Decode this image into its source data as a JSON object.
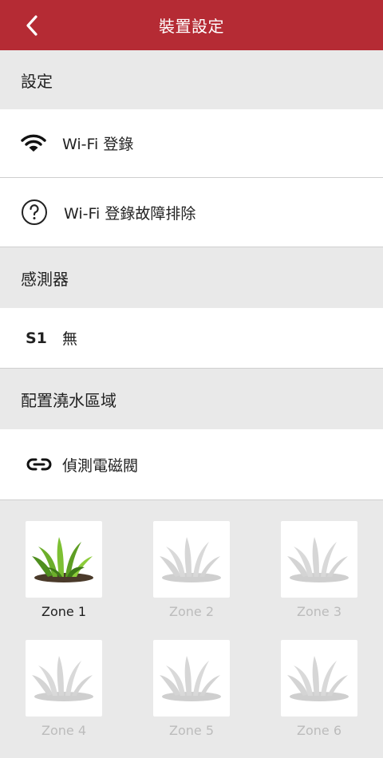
{
  "header": {
    "title": "裝置設定",
    "back_icon": "chevron-left-icon"
  },
  "settings": {
    "section_label": "設定",
    "wifi_login": {
      "label": "Wi-Fi 登錄",
      "icon": "wifi-icon"
    },
    "wifi_troubleshoot": {
      "label": "Wi-Fi 登錄故障排除",
      "icon": "help-circle-icon"
    }
  },
  "sensors": {
    "section_label": "感測器",
    "s1": {
      "code": "S1",
      "value": "無"
    }
  },
  "zones_config": {
    "section_label": "配置澆水區域",
    "detect_valves": {
      "label": "偵測電磁閥",
      "icon": "link-icon"
    }
  },
  "zones": [
    {
      "label": "Zone 1",
      "active": true
    },
    {
      "label": "Zone 2",
      "active": false
    },
    {
      "label": "Zone 3",
      "active": false
    },
    {
      "label": "Zone 4",
      "active": false
    },
    {
      "label": "Zone 5",
      "active": false
    },
    {
      "label": "Zone 6",
      "active": false
    }
  ],
  "colors": {
    "header": "#b52b34",
    "plant_green": "#6cae2b",
    "inactive_gray": "#bcbcbc"
  }
}
